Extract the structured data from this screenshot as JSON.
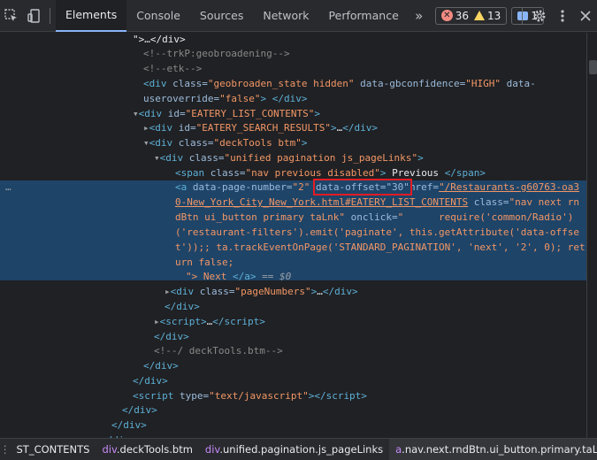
{
  "toolbar": {
    "tabs": [
      "Elements",
      "Console",
      "Sources",
      "Network",
      "Performance"
    ],
    "more": "»",
    "errors": "36",
    "warnings": "13",
    "messages": "1",
    "colors": {
      "accent": "#8ab4f8",
      "error": "#f28b82",
      "warning": "#fdd663"
    }
  },
  "dom": {
    "l0a": "\">…</div>",
    "l1": "<!--trkP:geobroadening-->",
    "l2": "<!--etk-->",
    "l3a": "geobroaden_state hidden",
    "l3b": "HIGH",
    "l3c": "false",
    "l3d": "data-gbconfidence=",
    "l3e": "data-",
    "l3f": "useroverride=",
    "l4": "EATERY_LIST_CONTENTS",
    "l5": "EATERY_SEARCH_RESULTS",
    "l6": "deckTools btm",
    "l7": "unified pagination js_pageLinks",
    "l8a": "nav previous disabled",
    "l8b": " Previous ",
    "l9a": "data-page-number=",
    "l9b": "\"2\"",
    "l9c": "data-offset=\"30\"",
    "l9d": "href=",
    "l9e": "\"/Restaurants-g60763-oa3",
    "l10a": "0-New_York_City_New_York.html#EATERY_LIST_CONTENTS",
    "l10b": " class=",
    "l10c": "\"nav next rn",
    "l11a": "dBtn ui_button primary taLnk\"",
    "l11b": " onclick=",
    "l11c": "\"      require('common/Radio')",
    "l12": "('restaurant-filters').emit('paginate', this.getAttribute('data-offse",
    "l13": "t'));; ta.trackEventOnPage('STANDARD_PAGINATION', 'next', '2', 0); ret",
    "l14": "urn false;",
    "l15a": "\"> Next ",
    "l15b": " == $0",
    "l16": "pageNumbers",
    "l21": "<!--/ deckTools.btm-->",
    "l25": "text/javascript"
  },
  "breadcrumbs": [
    {
      "tag": "",
      "cls": "ST_CONTENTS"
    },
    {
      "tag": "div",
      "cls": ".deckTools.btm"
    },
    {
      "tag": "div",
      "cls": ".unified.pagination.js_pageLinks"
    },
    {
      "tag": "a",
      "cls": ".nav.next.rndBtn.ui_button.primary.taLnk"
    }
  ]
}
